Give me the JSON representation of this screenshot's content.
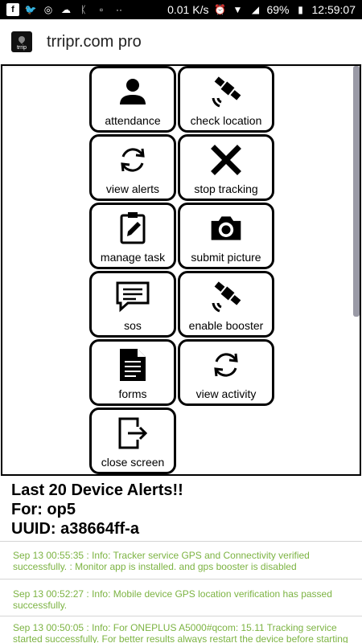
{
  "status_bar": {
    "speed": "0.01 K/s",
    "battery": "69%",
    "time": "12:59:07"
  },
  "app": {
    "title": "trripr.com pro",
    "logo_text": "trrip"
  },
  "buttons": [
    {
      "label": "attendance",
      "icon": "person-icon"
    },
    {
      "label": "check location",
      "icon": "satellite-icon"
    },
    {
      "label": "view alerts",
      "icon": "refresh-icon"
    },
    {
      "label": "stop tracking",
      "icon": "close-x-icon"
    },
    {
      "label": "manage task",
      "icon": "clipboard-edit-icon"
    },
    {
      "label": "submit picture",
      "icon": "camera-icon"
    },
    {
      "label": "sos",
      "icon": "message-icon"
    },
    {
      "label": "enable booster",
      "icon": "satellite-icon"
    },
    {
      "label": "forms",
      "icon": "document-icon"
    },
    {
      "label": "view activity",
      "icon": "refresh-icon"
    },
    {
      "label": "close screen",
      "icon": "exit-icon"
    }
  ],
  "alerts": {
    "heading_line1": "Last 20 Device Alerts!!",
    "heading_line2": "For: op5",
    "heading_line3": "UUID: a38664ff-a",
    "items": [
      {
        "line1": "Sep 13 00:55:35 : Info: Tracker service GPS and Connectivity verified",
        "line2": "successfully. : Monitor app is installed. and gps booster is disabled"
      },
      {
        "line1": "Sep 13 00:52:27 : Info: Mobile device GPS location verification has passed",
        "line2": "successfully."
      },
      {
        "line1": "Sep 13 00:50:05 : Info: For ONEPLUS A5000#qcom: 15.11 Tracking service",
        "line2": "started successfully. For better results always restart the device before starting"
      }
    ]
  },
  "colors": {
    "alert_text": "#7cb342",
    "scrollbar": "#9a9aa6"
  }
}
